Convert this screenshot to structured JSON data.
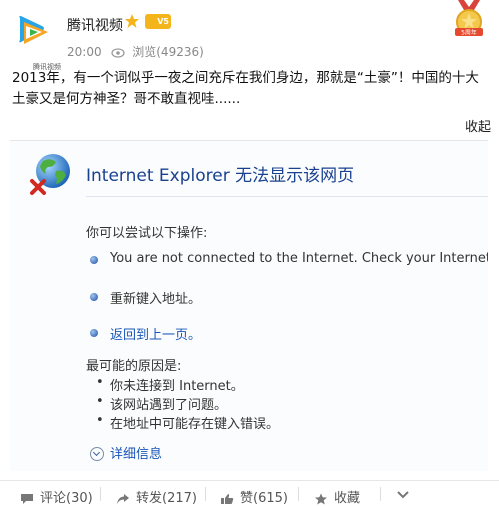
{
  "post": {
    "author": "腾讯视频",
    "avatar_caption": "腾讯视频",
    "vip_badge": "V5",
    "time": "20:00",
    "views_label": "浏览(49236)",
    "text": "2013年，有一个词似乎一夜之间充斥在我们身边，那就是“土豪”！中国的十大土豪又是何方神圣？哥不敢直视哇......",
    "collapse_label": "收起",
    "medal_label": "5周年"
  },
  "ie_error": {
    "title": "Internet Explorer 无法显示该网页",
    "try_heading": "你可以尝试以下操作:",
    "options": [
      "You are not connected to the Internet. Check your Internet",
      "重新键入地址。",
      "返回到上一页。"
    ],
    "causes_heading": "最可能的原因是:",
    "causes": [
      "你未连接到 Internet。",
      "该网站遇到了问题。",
      "在地址中可能存在键入错误。"
    ],
    "details_label": "详细信息"
  },
  "actions": {
    "comment": "评论(30)",
    "share": "转发(217)",
    "like": "赞(615)",
    "favorite": "收藏"
  },
  "colors": {
    "ie_title_blue": "#19418f",
    "link_blue": "#1a56b8",
    "vip_gold": "#f3b51b"
  }
}
